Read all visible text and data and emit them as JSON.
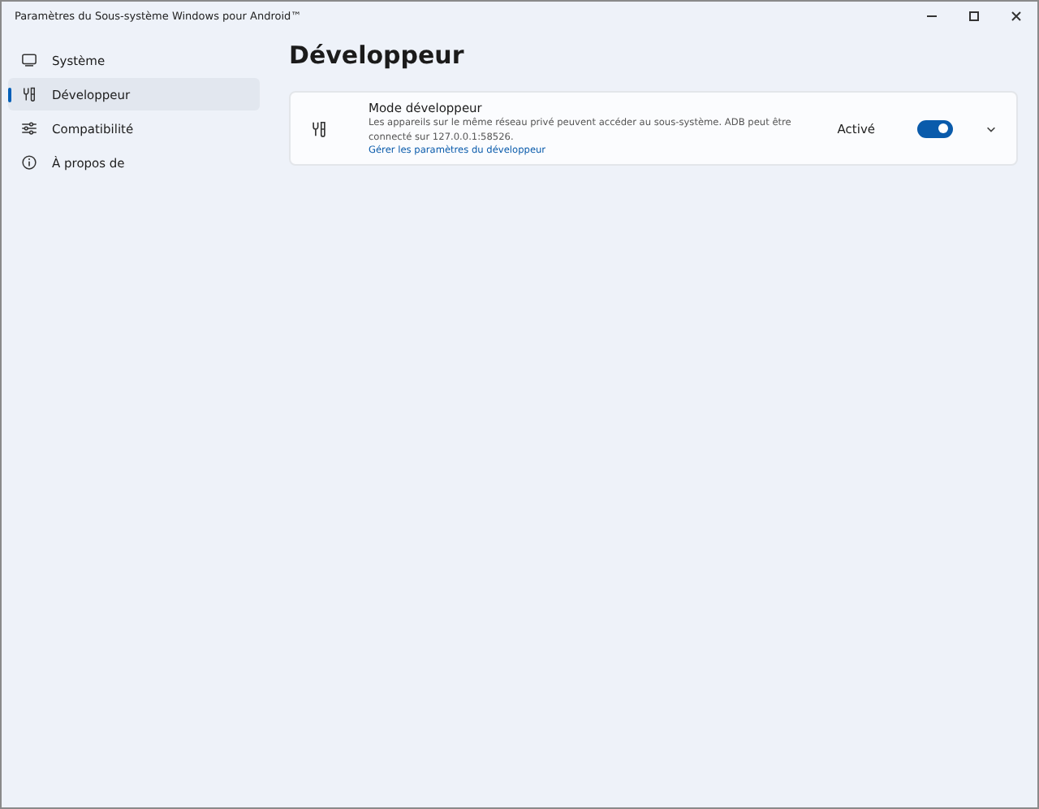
{
  "window": {
    "title": "Paramètres du Sous-système Windows pour Android™"
  },
  "sidebar": {
    "items": [
      {
        "label": "Système",
        "selected": false
      },
      {
        "label": "Développeur",
        "selected": true
      },
      {
        "label": "Compatibilité",
        "selected": false
      },
      {
        "label": "À propos de",
        "selected": false
      }
    ]
  },
  "page": {
    "title": "Développeur"
  },
  "settings": [
    {
      "title": "Mode développeur",
      "description": "Les appareils sur le même réseau privé peuvent accéder au sous-système. ADB peut être connecté sur 127.0.0.1:58526.",
      "link": "Gérer les paramètres du développeur",
      "status": "Activé",
      "on": true,
      "expanded": false
    }
  ]
}
